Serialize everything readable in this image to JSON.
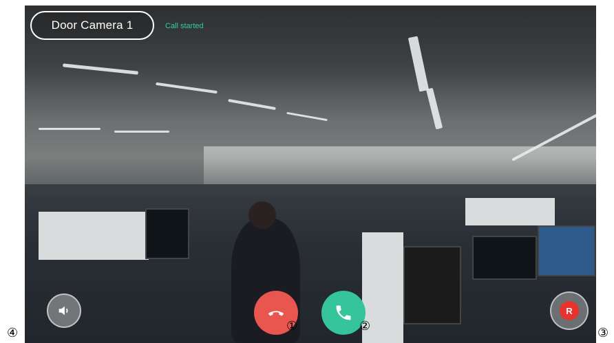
{
  "header": {
    "camera_name": "Door Camera 1",
    "call_status": "Call started"
  },
  "controls": {
    "mute": {
      "icon": "mute-icon"
    },
    "hangup": {
      "icon": "phone-hangup-icon",
      "color": "#e8564f"
    },
    "answer": {
      "icon": "phone-answer-icon",
      "color": "#36c49a"
    },
    "record": {
      "icon": "record-icon",
      "label": "R",
      "color": "#e8322e"
    }
  },
  "markers": {
    "m1": "①",
    "m2": "②",
    "m3": "③",
    "m4": "④"
  }
}
